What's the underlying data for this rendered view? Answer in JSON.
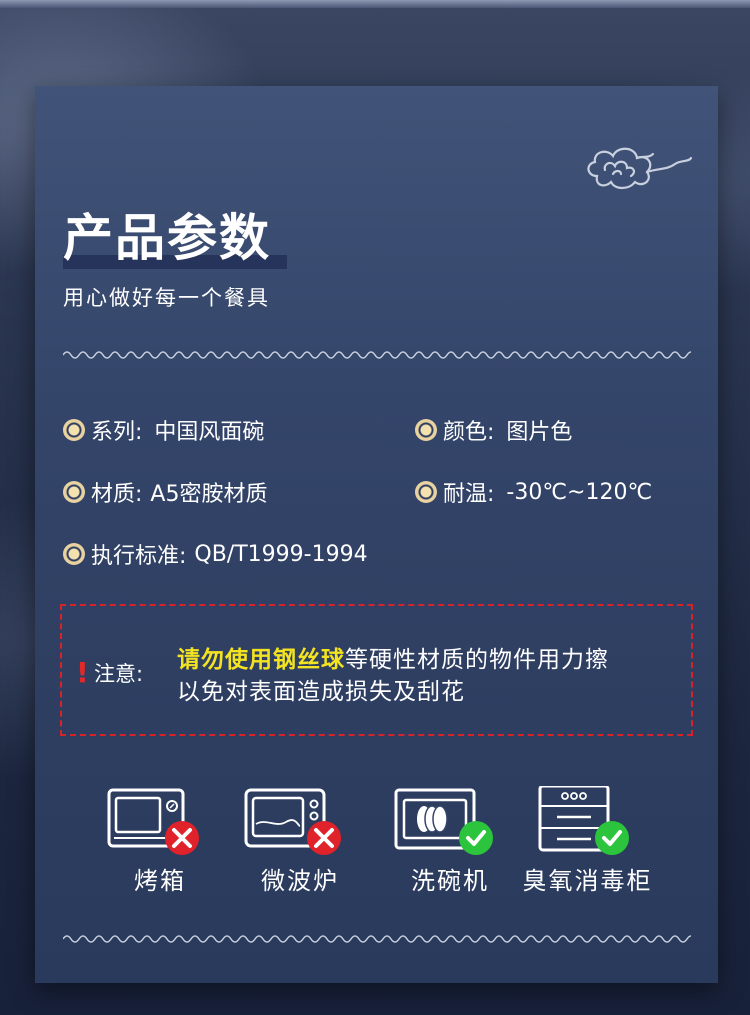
{
  "title": "产品参数",
  "subtitle": "用心做好每一个餐具",
  "specs": [
    {
      "label": "系列:",
      "value": "中国风面碗"
    },
    {
      "label": "颜色:",
      "value": "图片色"
    },
    {
      "label": "材质:",
      "value": "A5密胺材质"
    },
    {
      "label": "耐温:",
      "value": "-30℃~120℃"
    },
    {
      "label": "执行标准:",
      "value": "QB/T1999-1994"
    }
  ],
  "notice": {
    "mark": "!",
    "label": "注意:",
    "highlight": "请勿使用钢丝球",
    "line1_rest": "等硬性材质的物件用力擦",
    "line2": "以免对表面造成损失及刮花"
  },
  "appliances": [
    {
      "label": "烤箱",
      "icon": "oven-icon",
      "allowed": false
    },
    {
      "label": "微波炉",
      "icon": "microwave-icon",
      "allowed": false
    },
    {
      "label": "洗碗机",
      "icon": "dishwasher-icon",
      "allowed": true
    },
    {
      "label": "臭氧消毒柜",
      "icon": "sterilizer-cabinet-icon",
      "allowed": true
    }
  ],
  "colors": {
    "card": "#34456a",
    "highlight": "#f3e320",
    "notice_border": "#d8222a",
    "allowed": "#2cc43c",
    "forbidden": "#e0222a"
  }
}
